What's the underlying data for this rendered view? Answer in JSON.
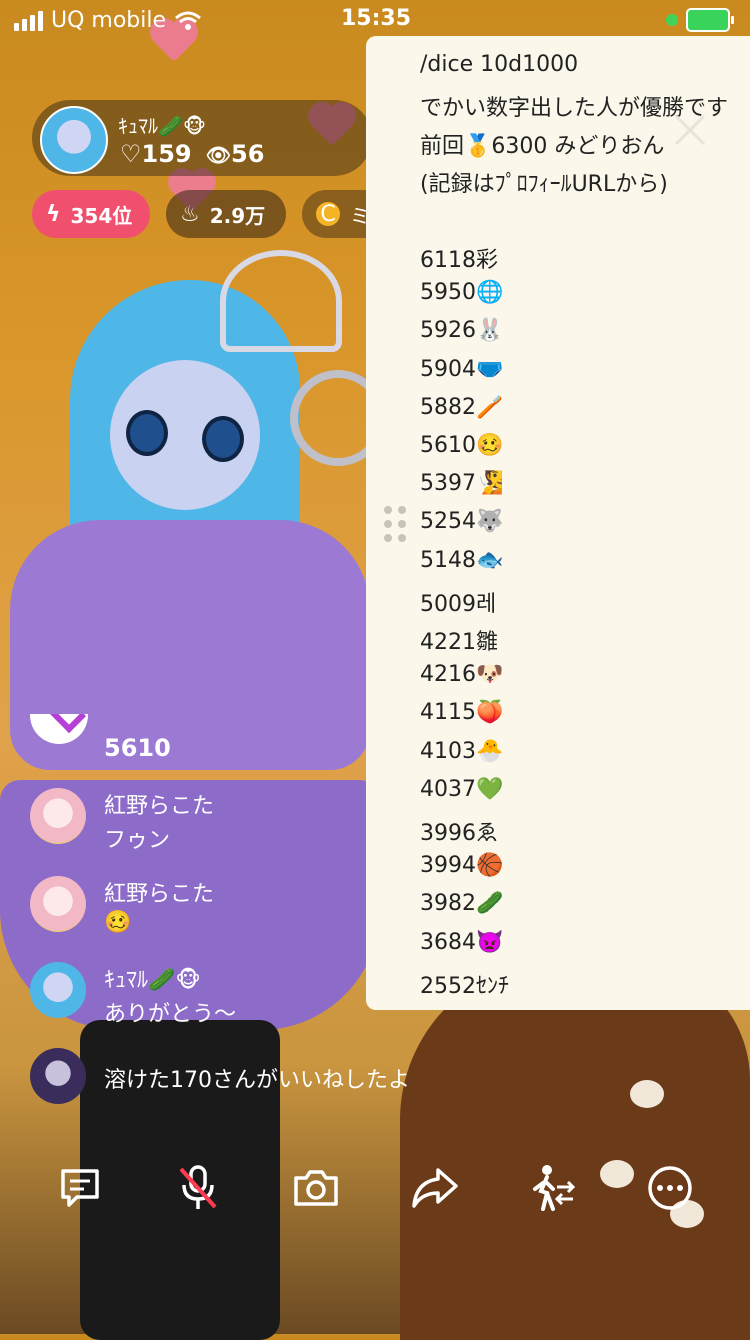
{
  "status_bar": {
    "carrier": "UQ mobile",
    "time": "15:35"
  },
  "host": {
    "name": "ｷｭﾏﾙ🥒🐵",
    "likes": "♡159",
    "viewers": "56"
  },
  "badges": {
    "rank": "354位",
    "fans": "2.9万",
    "mission": "ミッション"
  },
  "chat": [
    {
      "name": "",
      "message": "5610"
    },
    {
      "name": "紅野らこた",
      "message": "フゥン"
    },
    {
      "name": "紅野らこた",
      "message": "🥴"
    },
    {
      "name": "ｷｭﾏﾙ🥒🐵",
      "message": "ありがとう～"
    },
    {
      "name": "",
      "message": "溶けた170さんがいいねしたよ"
    }
  ],
  "dice_panel": {
    "command": "/dice 10d1000",
    "description": "でかい数字出した人が優勝です",
    "previous": "前回🥇6300 みどりおん",
    "note": "(記録はﾌﾟﾛﾌｨｰﾙURLから)",
    "scores": [
      "6118彩",
      "5950🌐",
      "5926🐰",
      "5904🩲",
      "5882🪥",
      "5610🥴",
      "5397🧏",
      "5254🐺",
      "5148🐟",
      "5009레",
      "4221雛",
      "4216🐶",
      "4115🍑",
      "4103🐣",
      "4037💚",
      "3996ゑ",
      "3994🏀",
      "3982🥒",
      "3684👿",
      "2552ｾﾝﾁ"
    ]
  },
  "toolbar": {
    "icons": [
      "comment-icon",
      "mic-muted-icon",
      "camera-icon",
      "share-icon",
      "collab-icon",
      "more-icon"
    ]
  },
  "colors": {
    "rank_badge": "#f0506e",
    "panel_bg": "#fbf7ea",
    "mission_coin": "#f4b425"
  }
}
